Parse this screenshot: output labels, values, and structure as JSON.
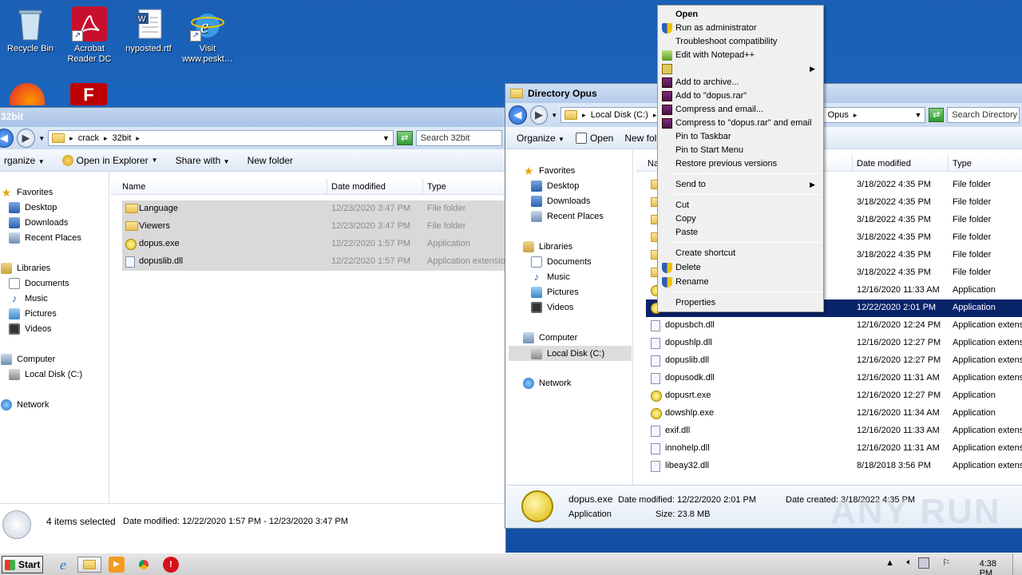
{
  "desktop": {
    "icons": [
      {
        "label": "Recycle Bin"
      },
      {
        "label": "Acrobat Reader DC"
      },
      {
        "label": "nyposted.rtf"
      },
      {
        "label": "Visit www.peskt…"
      }
    ]
  },
  "left_window": {
    "title": "32bit",
    "breadcrumb": [
      "crack",
      "32bit"
    ],
    "search_placeholder": "Search 32bit",
    "toolbar": {
      "organize": "rganize",
      "open_in_explorer": "Open in Explorer",
      "share_with": "Share with",
      "new_folder": "New folder"
    },
    "nav": {
      "favorites": "Favorites",
      "desktop": "Desktop",
      "downloads": "Downloads",
      "recent_places": "Recent Places",
      "libraries": "Libraries",
      "documents": "Documents",
      "music": "Music",
      "pictures": "Pictures",
      "videos": "Videos",
      "computer": "Computer",
      "local_disk": "Local Disk (C:)",
      "network": "Network"
    },
    "columns": {
      "name": "Name",
      "date_modified": "Date modified",
      "type": "Type"
    },
    "files": [
      {
        "name": "Language",
        "date": "12/23/2020 3:47 PM",
        "type": "File folder",
        "kind": "folder"
      },
      {
        "name": "Viewers",
        "date": "12/23/2020 3:47 PM",
        "type": "File folder",
        "kind": "folder"
      },
      {
        "name": "dopus.exe",
        "date": "12/22/2020 1:57 PM",
        "type": "Application",
        "kind": "exe"
      },
      {
        "name": "dopuslib.dll",
        "date": "12/22/2020 1:57 PM",
        "type": "Application extensio",
        "kind": "dll"
      }
    ],
    "status": {
      "count": "4 items selected",
      "detail": "Date modified: 12/22/2020 1:57 PM - 12/23/2020 3:47 PM"
    }
  },
  "right_window": {
    "title": "Directory Opus",
    "address": "Local Disk (C:)",
    "address_tail": "Opus",
    "search_placeholder": "Search Directory O",
    "toolbar": {
      "organize": "Organize",
      "open": "Open",
      "new_folder": "New fol"
    },
    "nav": {
      "favorites": "Favorites",
      "desktop": "Desktop",
      "downloads": "Downloads",
      "recent_places": "Recent Places",
      "libraries": "Libraries",
      "documents": "Documents",
      "music": "Music",
      "pictures": "Pictures",
      "videos": "Videos",
      "computer": "Computer",
      "local_disk": "Local Disk (C:)",
      "network": "Network"
    },
    "columns": {
      "name": "Na",
      "date_modified": "Date modified",
      "type": "Type"
    },
    "files": [
      {
        "name": "",
        "date": "3/18/2022 4:35 PM",
        "type": "File folder",
        "kind": "folder"
      },
      {
        "name": "",
        "date": "3/18/2022 4:35 PM",
        "type": "File folder",
        "kind": "folder"
      },
      {
        "name": "",
        "date": "3/18/2022 4:35 PM",
        "type": "File folder",
        "kind": "folder"
      },
      {
        "name": "",
        "date": "3/18/2022 4:35 PM",
        "type": "File folder",
        "kind": "folder"
      },
      {
        "name": "",
        "date": "3/18/2022 4:35 PM",
        "type": "File folder",
        "kind": "folder"
      },
      {
        "name": "",
        "date": "3/18/2022 4:35 PM",
        "type": "File folder",
        "kind": "folder"
      },
      {
        "name": "",
        "date": "12/16/2020 11:33 AM",
        "type": "Application",
        "kind": "exe"
      },
      {
        "name": "",
        "date": "12/22/2020 2:01 PM",
        "type": "Application",
        "kind": "exe",
        "selected": true
      },
      {
        "name": "dopusbch.dll",
        "date": "12/16/2020 12:24 PM",
        "type": "Application extens",
        "kind": "dll"
      },
      {
        "name": "dopushlp.dll",
        "date": "12/16/2020 12:27 PM",
        "type": "Application extens",
        "kind": "dll"
      },
      {
        "name": "dopuslib.dll",
        "date": "12/16/2020 12:27 PM",
        "type": "Application extens",
        "kind": "dll"
      },
      {
        "name": "dopusodk.dll",
        "date": "12/16/2020 11:31 AM",
        "type": "Application extens",
        "kind": "dll"
      },
      {
        "name": "dopusrt.exe",
        "date": "12/16/2020 12:27 PM",
        "type": "Application",
        "kind": "exe"
      },
      {
        "name": "dowshlp.exe",
        "date": "12/16/2020 11:34 AM",
        "type": "Application",
        "kind": "exe"
      },
      {
        "name": "exif.dll",
        "date": "12/16/2020 11:33 AM",
        "type": "Application extens",
        "kind": "dll"
      },
      {
        "name": "innohelp.dll",
        "date": "12/16/2020 11:31 AM",
        "type": "Application extens",
        "kind": "dll"
      },
      {
        "name": "libeay32.dll",
        "date": "8/18/2018 3:56 PM",
        "type": "Application extens",
        "kind": "dll"
      }
    ],
    "details": {
      "name": "dopus.exe",
      "date_modified": "Date modified: 12/22/2020 2:01 PM",
      "date_created": "Date created: 3/18/2022 4:35 PM",
      "type": "Application",
      "size": "Size: 23.8 MB"
    }
  },
  "context_menu": {
    "items": [
      {
        "label": "Open",
        "bold": true
      },
      {
        "label": "Run as administrator",
        "icon": "shield-icon"
      },
      {
        "label": "Troubleshoot compatibility"
      },
      {
        "label": "Edit with Notepad++",
        "icon": "notepadpp-icon"
      },
      {
        "label": "",
        "icon": "lock-icon",
        "submenu": true
      },
      {
        "label": "Add to archive...",
        "icon": "winrar-icon"
      },
      {
        "label": "Add to \"dopus.rar\"",
        "icon": "winrar-icon"
      },
      {
        "label": "Compress and email...",
        "icon": "winrar-icon"
      },
      {
        "label": "Compress to \"dopus.rar\" and email",
        "icon": "winrar-icon"
      },
      {
        "label": "Pin to Taskbar"
      },
      {
        "label": "Pin to Start Menu"
      },
      {
        "label": "Restore previous versions"
      },
      {
        "label": "Send to",
        "submenu": true
      },
      {
        "label": "Cut"
      },
      {
        "label": "Copy"
      },
      {
        "label": "Paste"
      },
      {
        "label": "Create shortcut"
      },
      {
        "label": "Delete",
        "icon": "shield-icon"
      },
      {
        "label": "Rename",
        "icon": "shield-icon"
      },
      {
        "label": "Properties"
      }
    ]
  },
  "taskbar": {
    "start": "Start",
    "clock": "4:38 PM"
  },
  "watermark": "ANY RUN"
}
